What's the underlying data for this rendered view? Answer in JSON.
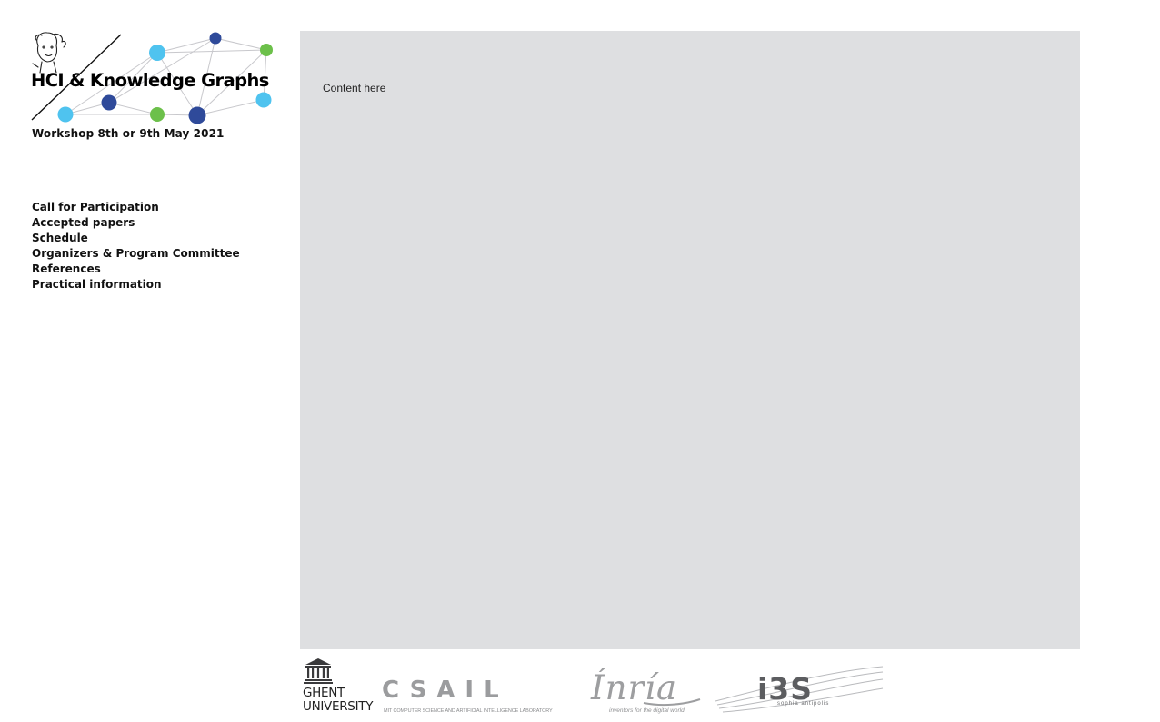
{
  "header": {
    "logo_title": "HCI & Knowledge Graphs",
    "workshop_date": "Workshop 8th or 9th May 2021"
  },
  "nav": {
    "items": [
      {
        "label": "Call for Participation"
      },
      {
        "label": "Accepted papers"
      },
      {
        "label": "Schedule"
      },
      {
        "label": "Organizers & Program Committee"
      },
      {
        "label": "References"
      },
      {
        "label": "Practical information"
      }
    ]
  },
  "main": {
    "content_text": "Content here"
  },
  "footer": {
    "ghent": {
      "line1": "GHENT",
      "line2": "UNIVERSITY",
      "icon": "ghent-building-icon"
    },
    "csail": {
      "name": "CSAIL",
      "subtitle": "MIT COMPUTER SCIENCE AND ARTIFICIAL INTELLIGENCE LABORATORY"
    },
    "inria": {
      "name": "Ínría",
      "subtitle": "inventors for the digital world"
    },
    "i3s": {
      "name": "i3S",
      "subtitle": "sophia antipolis"
    }
  },
  "colors": {
    "panel_bg": "#dedfe1",
    "node_light_blue": "#4fc3ef",
    "node_dark_blue": "#2f4a9a",
    "node_green": "#6cc04a"
  }
}
